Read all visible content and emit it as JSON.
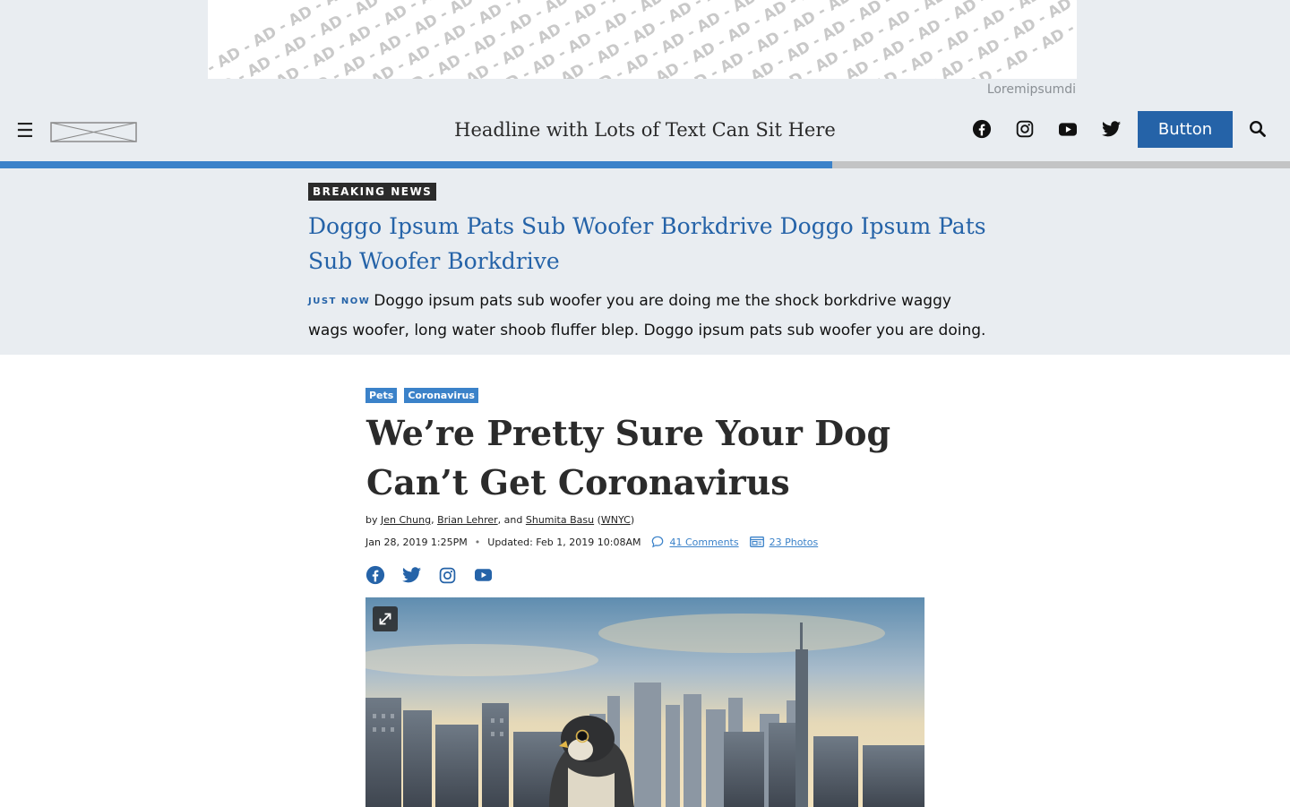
{
  "ad": {
    "caption": "Loremipsumdi",
    "pattern_text": "AD -"
  },
  "header": {
    "headline": "Headline with Lots of Text Can Sit Here",
    "button_label": "Button",
    "menu_icon": "hamburger-icon",
    "social_icons": [
      "facebook-icon",
      "instagram-icon",
      "youtube-icon",
      "twitter-icon"
    ],
    "search_icon": "search-icon"
  },
  "progress": {
    "fraction": 0.645
  },
  "breaking": {
    "badge": "BREAKING NEWS",
    "title": "Doggo Ipsum Pats Sub Woofer Borkdrive Doggo Ipsum Pats Sub Woofer Borkdrive",
    "timestamp_label": "JUST NOW",
    "body": "Doggo ipsum pats sub woofer you are doing me the shock borkdrive waggy wags woofer, long water shoob fluffer blep. Doggo ipsum pats sub woofer you are doing."
  },
  "article": {
    "tags": [
      "Pets",
      "Coronavirus"
    ],
    "title": "We’re Pretty Sure Your Dog Can’t Get Coronavirus",
    "byline": {
      "prefix": "by",
      "authors": [
        "Jen Chung",
        "Brian Lehrer",
        "Shumita Basu"
      ],
      "separator": ",",
      "conjunction": ", and",
      "org": "WNYC"
    },
    "date": "Jan 28, 2019 1:25PM",
    "bullet": "•",
    "updated": "Updated: Feb 1, 2019 10:08AM",
    "comments": "41 Comments",
    "photos": "23 Photos",
    "share_icons": [
      "facebook-icon",
      "twitter-icon",
      "instagram-icon",
      "youtube-icon"
    ]
  },
  "colors": {
    "brand_blue": "#2563a8",
    "tag_blue": "#3b82c9",
    "band_gray": "#e9edf1",
    "text_dark": "#2b2b2b"
  }
}
